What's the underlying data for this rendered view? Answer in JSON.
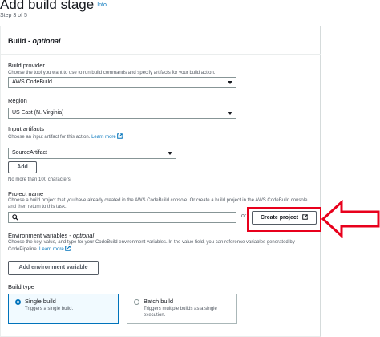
{
  "header": {
    "title": "Add build stage",
    "info": "Info",
    "step": "Step 3 of 5"
  },
  "panel": {
    "title_prefix": "Build - ",
    "title_optional": "optional"
  },
  "build_provider": {
    "label": "Build provider",
    "description": "Choose the tool you want to use to run build commands and specify artifacts for your build action.",
    "value": "AWS CodeBuild"
  },
  "region": {
    "label": "Region",
    "value": "US East (N. Virginia)"
  },
  "input_artifacts": {
    "label": "Input artifacts",
    "description": "Choose an input artifact for this action.",
    "learn_more": "Learn more",
    "value": "SourceArtifact",
    "add_label": "Add",
    "limit_note": "No more than 100 characters"
  },
  "project_name": {
    "label": "Project name",
    "description_line1": "Choose a build project that you have already created in the AWS CodeBuild console. Or create a build project in the AWS CodeBuild console",
    "description_line2": "and then return to this task.",
    "value": "",
    "or_text": "or",
    "create_label": "Create project"
  },
  "env_vars": {
    "label_prefix": "Environment variables - ",
    "label_optional": "optional",
    "description_line1": "Choose the key, value, and type for your CodeBuild environment variables. In the value field, you can reference variables generated by",
    "description_line2": "CodePipeline.",
    "learn_more": "Learn more",
    "add_label": "Add environment variable"
  },
  "build_type": {
    "label": "Build type",
    "options": [
      {
        "title": "Single build",
        "description": "Triggers a single build.",
        "selected": true
      },
      {
        "title": "Batch build",
        "description_line1": "Triggers multiple builds as a single",
        "description_line2": "execution.",
        "selected": false
      }
    ]
  },
  "annotation": {
    "highlight_color": "#e8001c",
    "arrow_direction": "left"
  }
}
